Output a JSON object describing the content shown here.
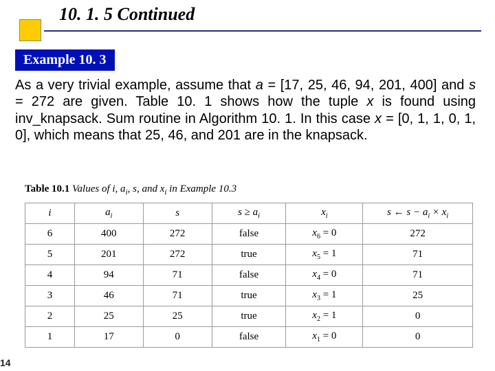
{
  "header": {
    "section_number": "10. 1. 5  Continued"
  },
  "example": {
    "label": "Example 10. 3"
  },
  "body": {
    "p_open": "As a very trivial example, assume that ",
    "a_var": "a",
    "a_eq": " = [17, 25, 46, 94, 201, 400] and ",
    "s_var": "s",
    "s_eq": " = 272 are given. Table 10. 1 shows how the tuple ",
    "x_var1": "x",
    "mid": " is found using inv_knapsack. Sum routine in Algorithm 10. 1. In this case ",
    "x_var2": "x",
    "x_eq": " = [0, 1, 1, 0, 1, 0], which means that 25, 46, and 201 are in the knapsack."
  },
  "table": {
    "caption_lead": "Table 10.1",
    "caption_rest_a": "   Values of i, a",
    "caption_rest_sub1": "i",
    "caption_rest_b": ", s, and x",
    "caption_rest_sub2": "i",
    "caption_rest_c": " in Example 10.3",
    "head": {
      "i": "i",
      "ai_a": "a",
      "ai_sub": "i",
      "s": "s",
      "cmp_a": "s ≥ a",
      "cmp_sub": "i",
      "xi_a": "x",
      "xi_sub": "i",
      "upd_a": "s ← s − a",
      "upd_sub1": "i",
      "upd_b": " × x",
      "upd_sub2": "i"
    },
    "rows": [
      {
        "i": "6",
        "ai": "400",
        "s": "272",
        "cmp": "false",
        "xi_a": "x",
        "xi_sub": "6",
        "xi_b": " = 0",
        "upd": "272"
      },
      {
        "i": "5",
        "ai": "201",
        "s": "272",
        "cmp": "true",
        "xi_a": "x",
        "xi_sub": "5",
        "xi_b": " = 1",
        "upd": "71"
      },
      {
        "i": "4",
        "ai": "94",
        "s": "71",
        "cmp": "false",
        "xi_a": "x",
        "xi_sub": "4",
        "xi_b": " = 0",
        "upd": "71"
      },
      {
        "i": "3",
        "ai": "46",
        "s": "71",
        "cmp": "true",
        "xi_a": "x",
        "xi_sub": "3",
        "xi_b": " = 1",
        "upd": "25"
      },
      {
        "i": "2",
        "ai": "25",
        "s": "25",
        "cmp": "true",
        "xi_a": "x",
        "xi_sub": "2",
        "xi_b": " = 1",
        "upd": "0"
      },
      {
        "i": "1",
        "ai": "17",
        "s": "0",
        "cmp": "false",
        "xi_a": "x",
        "xi_sub": "1",
        "xi_b": " = 0",
        "upd": "0"
      }
    ]
  },
  "page": {
    "number": "14"
  }
}
